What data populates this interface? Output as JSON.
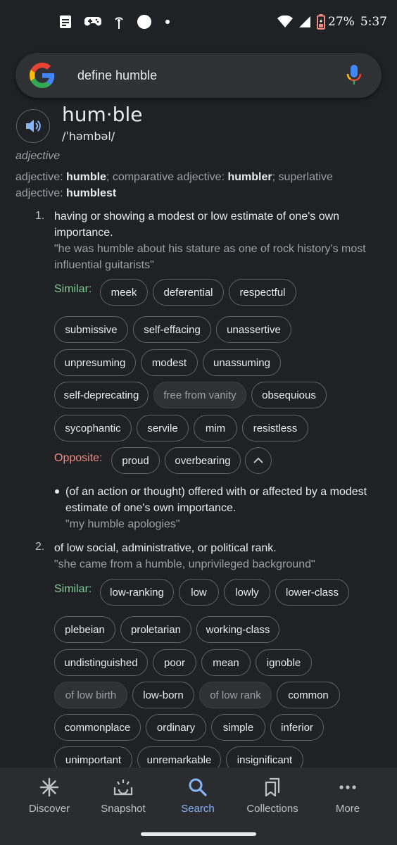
{
  "status_bar": {
    "battery": "27%",
    "time": "5:37",
    "icons": [
      "notes-icon",
      "game-controller-icon",
      "cast-icon",
      "circle-icon",
      "dot-icon",
      "wifi-icon",
      "signal-icon",
      "battery-icon"
    ]
  },
  "search": {
    "query": "define humble"
  },
  "entry": {
    "word": "hum·ble",
    "phonetic": "/ˈhəmbəl/",
    "part_of_speech": "adjective",
    "forms": {
      "l1": "adjective",
      "l1_word": "humble",
      "l2": "; comparative adjective",
      "l2_word": "humbler",
      "l3": "; superlative",
      "l4": "adjective",
      "l4_word": "humblest",
      "colon": ": "
    }
  },
  "sense1": {
    "number": "1.",
    "definition": "having or showing a modest or low estimate of one's own importance.",
    "example": "\"he was humble about his stature as one of rock history's most influential guitarists\"",
    "similar_label": "Similar:",
    "similar": [
      "meek",
      "deferential",
      "respectful",
      "submissive",
      "self-effacing",
      "unassertive",
      "unpresuming",
      "modest",
      "unassuming",
      "self-deprecating",
      "free from vanity",
      "obsequious",
      "sycophantic",
      "servile",
      "mim",
      "resistless"
    ],
    "opposite_label": "Opposite:",
    "opposite": [
      "proud",
      "overbearing"
    ],
    "subsense": {
      "definition": "(of an action or thought) offered with or affected by a modest estimate of one's own importance.",
      "example": "\"my humble apologies\""
    }
  },
  "sense2": {
    "number": "2.",
    "definition": "of low social, administrative, or political rank.",
    "example": "\"she came from a humble, unprivileged background\"",
    "similar_label": "Similar:",
    "similar": [
      "low-ranking",
      "low",
      "lowly",
      "lower-class",
      "plebeian",
      "proletarian",
      "working-class",
      "undistinguished",
      "poor",
      "mean",
      "ignoble",
      "of low birth",
      "low-born",
      "of low rank",
      "common",
      "commonplace",
      "ordinary",
      "simple",
      "inferior",
      "unimportant",
      "unremarkable",
      "insignificant"
    ]
  },
  "bottom_nav": [
    {
      "label": "Discover",
      "icon": "asterisk-icon"
    },
    {
      "label": "Snapshot",
      "icon": "snapshot-icon"
    },
    {
      "label": "Search",
      "icon": "search-icon",
      "active": true
    },
    {
      "label": "Collections",
      "icon": "collections-icon"
    },
    {
      "label": "More",
      "icon": "more-icon"
    }
  ],
  "colors": {
    "background": "#202124",
    "similar_label": "#81c995",
    "opposite_label": "#f28b82",
    "active_nav": "#8ab4f8"
  }
}
